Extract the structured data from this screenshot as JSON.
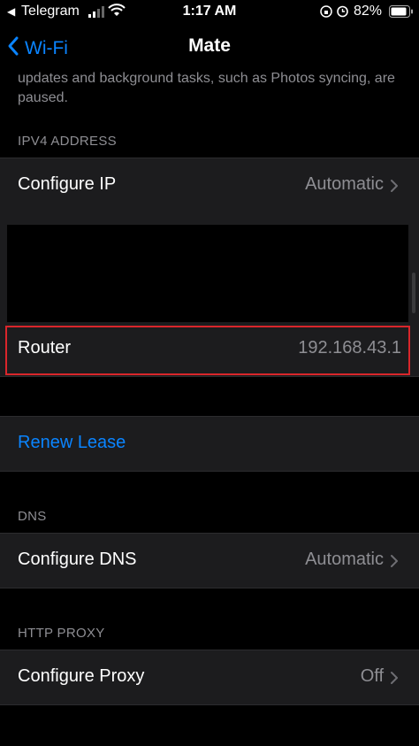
{
  "status_bar": {
    "back_app": "Telegram",
    "time": "1:17 AM",
    "battery": "82%"
  },
  "nav": {
    "back_label": "Wi-Fi",
    "title": "Mate"
  },
  "note": "updates and background tasks, such as Photos syncing, are paused.",
  "ipv4": {
    "header": "IPV4 ADDRESS",
    "configure_ip": {
      "label": "Configure IP",
      "value": "Automatic"
    },
    "router": {
      "label": "Router",
      "value": "192.168.43.1"
    }
  },
  "renew_lease": {
    "label": "Renew Lease"
  },
  "dns": {
    "header": "DNS",
    "configure_dns": {
      "label": "Configure DNS",
      "value": "Automatic"
    }
  },
  "proxy": {
    "header": "HTTP PROXY",
    "configure_proxy": {
      "label": "Configure Proxy",
      "value": "Off"
    }
  },
  "colors": {
    "accent": "#0a84ff",
    "highlight_border": "#d9262b",
    "cell_background": "#1c1c1e",
    "secondary_text": "#8e8e93"
  }
}
